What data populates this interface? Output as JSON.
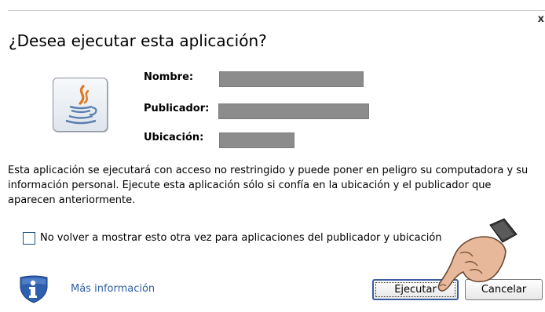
{
  "dialog": {
    "title": "¿Desea ejecutar esta aplicación?",
    "close_glyph": "x"
  },
  "fields": {
    "name_label": "Nombre:",
    "publisher_label": "Publicador:",
    "location_label": "Ubicación:"
  },
  "description": "Esta aplicación se ejecutará con acceso no restringido y puede poner en peligro su computadora y su información personal. Ejecute esta aplicación sólo si confía en la ubicación y el publicador que aparecen anteriormente.",
  "checkbox": {
    "label": "No volver a mostrar esto otra vez para aplicaciones del publicador y ubicación",
    "checked": false
  },
  "footer": {
    "more_info": "Más información",
    "run_button": "Ejecutar",
    "cancel_button": "Cancelar"
  },
  "icons": {
    "app": "java-icon",
    "info": "shield-info-icon",
    "cursor": "pointing-hand-icon"
  },
  "colors": {
    "accent": "#2e5fa6",
    "redaction": "#8c8c8c",
    "shield": "#2f5fb0"
  }
}
